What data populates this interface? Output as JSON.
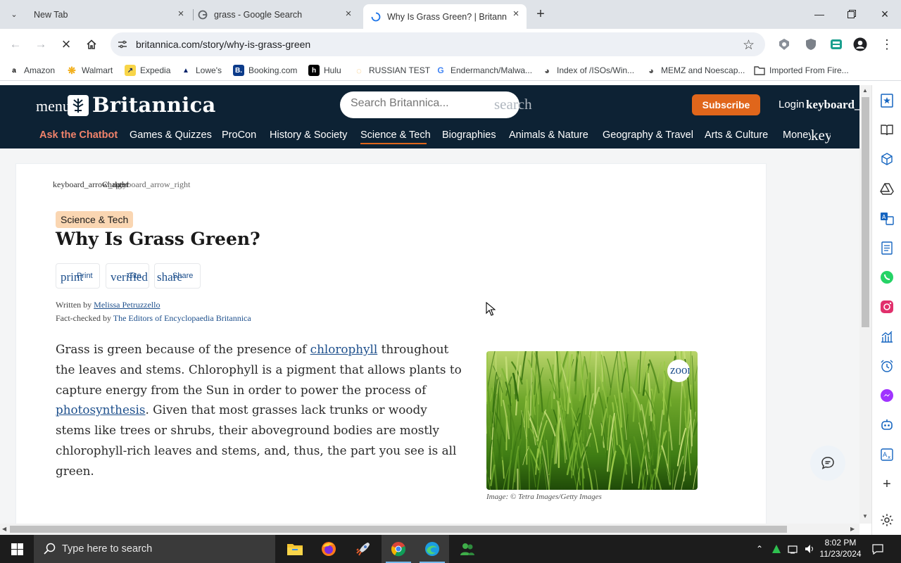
{
  "browser": {
    "tabs": [
      {
        "title": "New Tab"
      },
      {
        "title": "grass - Google Search"
      },
      {
        "title": "Why Is Grass Green? | Britannica",
        "active": true
      }
    ],
    "url": "britannica.com/story/why-is-grass-green",
    "bookmarks": [
      {
        "label": "Amazon",
        "icon": "amazon-icon"
      },
      {
        "label": "Walmart",
        "icon": "walmart-icon"
      },
      {
        "label": "Expedia",
        "icon": "expedia-icon"
      },
      {
        "label": "Lowe's",
        "icon": "lowes-icon"
      },
      {
        "label": "Booking.com",
        "icon": "booking-icon"
      },
      {
        "label": "Hulu",
        "icon": "hulu-icon"
      },
      {
        "label": "RUSSIAN TEST",
        "icon": "globe-icon"
      },
      {
        "label": "Endermanch/Malwa...",
        "icon": "google-icon"
      },
      {
        "label": "Index of /ISOs/Win...",
        "icon": "globe-icon"
      },
      {
        "label": "MEMZ and Noescap...",
        "icon": "globe-icon"
      },
      {
        "label": "Imported From Fire...",
        "icon": "folder-icon"
      }
    ]
  },
  "site": {
    "menu_label": "menu",
    "brand": "Britannica",
    "search_placeholder": "Search Britannica...",
    "search_icon_label": "search",
    "subscribe_label": "Subscribe",
    "login_label": "Login",
    "login_icon_label": "keyboard_arrow_down",
    "nav": [
      "Ask the Chatbot",
      "Games & Quizzes",
      "ProCon",
      "History & Society",
      "Science & Tech",
      "Biographies",
      "Animals & Nature",
      "Geography & Travel",
      "Arts & Culture",
      "Money"
    ],
    "nav_more_icon_label": "keyboard_arrow_down"
  },
  "article": {
    "crumb_text": "keyboard_arrow_right",
    "crumb_overlay": "Chapter",
    "crumb_overlay2": "keyboard_arrow_right",
    "topic": "Science & Tech",
    "title": "Why Is Grass Green?",
    "tools": [
      {
        "icon_text": "print",
        "label": "Print"
      },
      {
        "icon_text": "verified",
        "label": "Cite"
      },
      {
        "icon_text": "share",
        "label": "Share"
      }
    ],
    "written_by_label": "Written by",
    "author": "Melissa Petruzzello",
    "fact_checked_label": "Fact-checked by",
    "fact_checker": "The Editors of Encyclopaedia Britannica",
    "body": {
      "p1_a": "Grass is green because of the presence of ",
      "link1": "chlorophyll",
      "p1_b": " throughout the leaves and stems. Chlorophyll is a pigment that allows plants to capture energy from the Sun in order to power the process of ",
      "link2": "photosynthesis",
      "p1_c": ". Given that most grasses lack trunks or woody stems like trees or shrubs, their aboveground bodies are mostly chlorophyll-rich leaves and stems, and, thus, the part you see is all green."
    },
    "zoom_label": "zoom_in",
    "image_caption": "Image: © Tetra Images/Getty Images"
  },
  "taskbar": {
    "search_placeholder": "Type here to search",
    "time": "8:02 PM",
    "date": "11/23/2024"
  },
  "colors": {
    "header_bg": "#0d2234",
    "accent": "#e0661b",
    "link": "#1d4f8c",
    "badge_bg": "#fad6b2"
  }
}
